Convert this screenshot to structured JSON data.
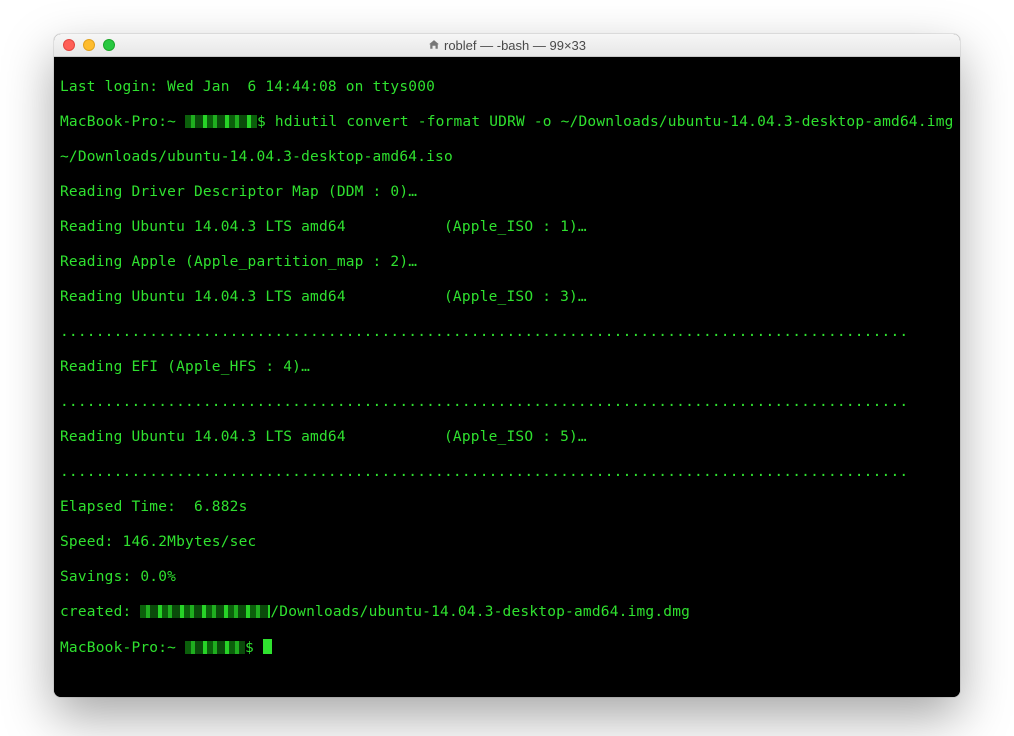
{
  "window": {
    "title": "roblef — -bash — 99×33"
  },
  "terminal": {
    "last_login": "Last login: Wed Jan  6 14:44:08 on ttys000",
    "prompt1_pre": "MacBook-Pro:~ ",
    "prompt1_post": "$ hdiutil convert -format UDRW -o ~/Downloads/ubuntu-14.04.3-desktop-amd64.img ",
    "cmd_cont": "~/Downloads/ubuntu-14.04.3-desktop-amd64.iso",
    "read1": "Reading Driver Descriptor Map (DDM : 0)…",
    "read2": "Reading Ubuntu 14.04.3 LTS amd64           (Apple_ISO : 1)…",
    "read3": "Reading Apple (Apple_partition_map : 2)…",
    "read4": "Reading Ubuntu 14.04.3 LTS amd64           (Apple_ISO : 3)…",
    "dots": "...............................................................................................",
    "read5": "Reading EFI (Apple_HFS : 4)…",
    "read6": "Reading Ubuntu 14.04.3 LTS amd64           (Apple_ISO : 5)…",
    "elapsed": "Elapsed Time:  6.882s",
    "speed": "Speed: 146.2Mbytes/sec",
    "savings": "Savings: 0.0%",
    "created_pre": "created: ",
    "created_post": "/Downloads/ubuntu-14.04.3-desktop-amd64.img.dmg",
    "prompt2_pre": "MacBook-Pro:~ ",
    "prompt2_post": "$ "
  }
}
